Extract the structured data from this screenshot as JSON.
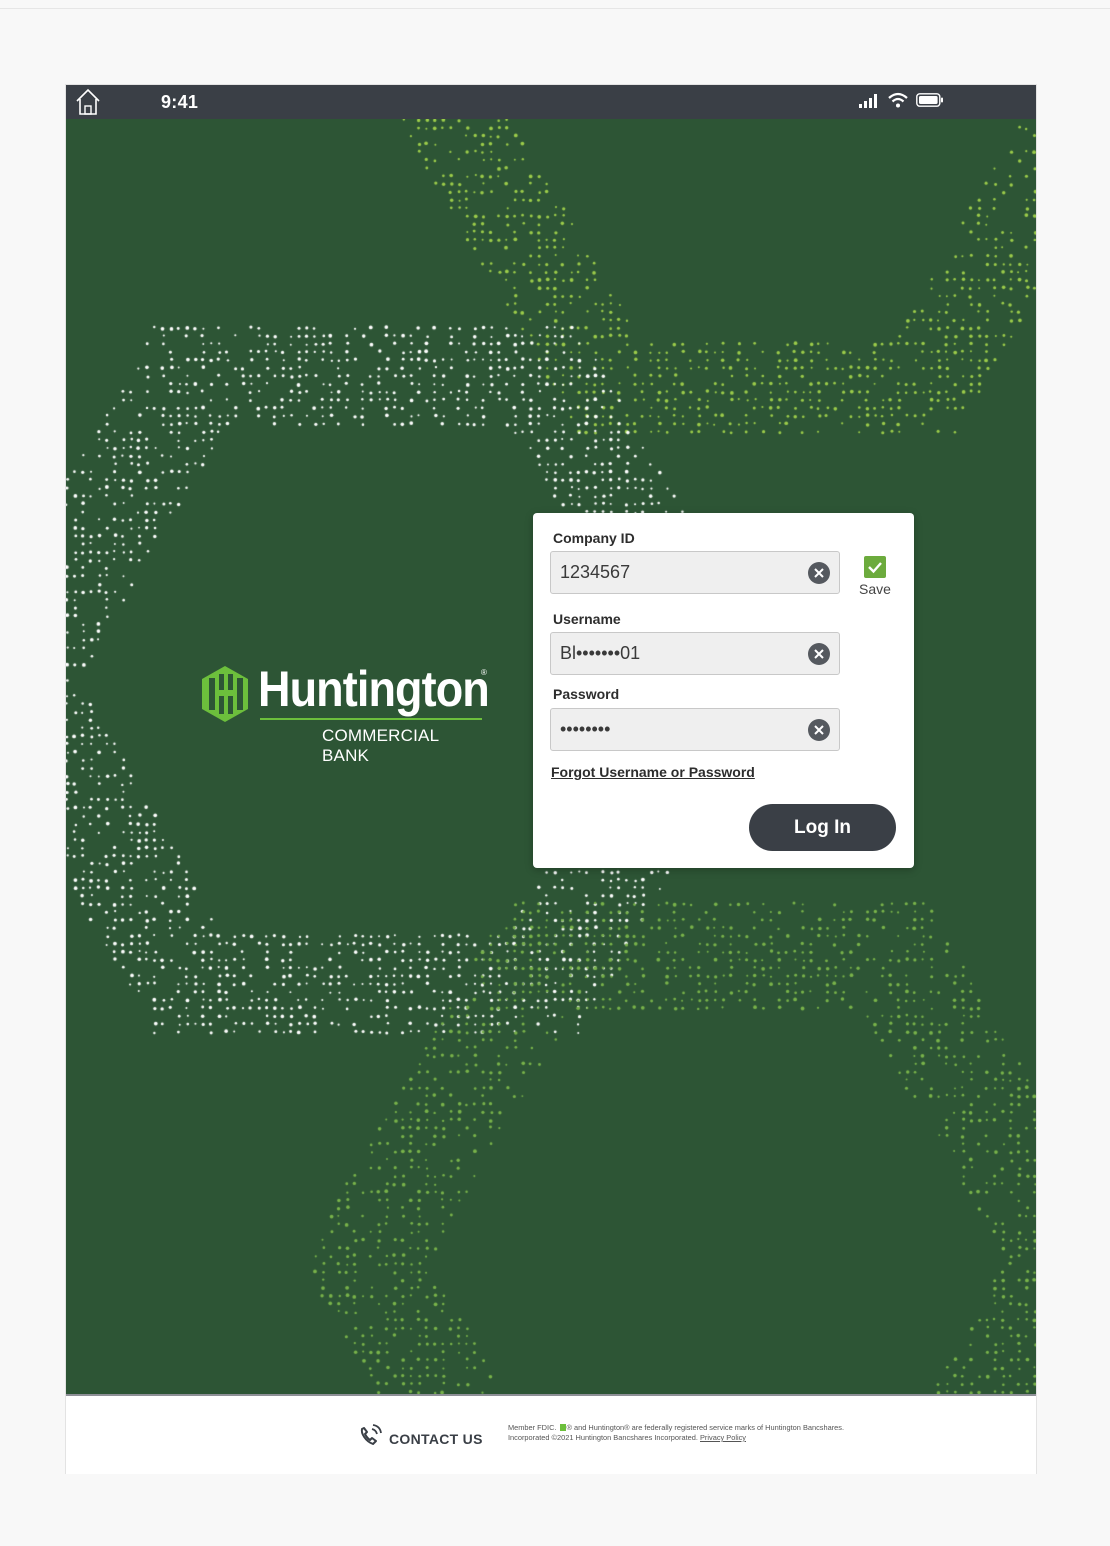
{
  "status_bar": {
    "time": "9:41",
    "icons": [
      "home-icon",
      "signal-icon",
      "wifi-icon",
      "battery-icon"
    ]
  },
  "brand": {
    "name": "Huntington",
    "subtitle": "COMMERCIAL BANK",
    "registered": "®"
  },
  "login": {
    "company_id": {
      "label": "Company ID",
      "value": "1234567"
    },
    "save": {
      "label": "Save",
      "checked": true
    },
    "username": {
      "label": "Username",
      "value": "Bl•••••••01"
    },
    "password": {
      "label": "Password",
      "value": "••••••••"
    },
    "forgot_link": "Forgot Username or Password",
    "login_button": "Log In"
  },
  "footer": {
    "contact_label": "CONTACT US",
    "legal_part1": "Member FDIC.",
    "legal_part2": "® and Huntington® are federally registered service marks of Huntington Bancshares. Incorporated ©2021 Huntington Bancshares Incorporated.",
    "privacy_link": "Privacy Policy"
  },
  "colors": {
    "hero_green": "#2d5535",
    "accent_green": "#6cbf3c",
    "dark": "#3a3f46"
  }
}
